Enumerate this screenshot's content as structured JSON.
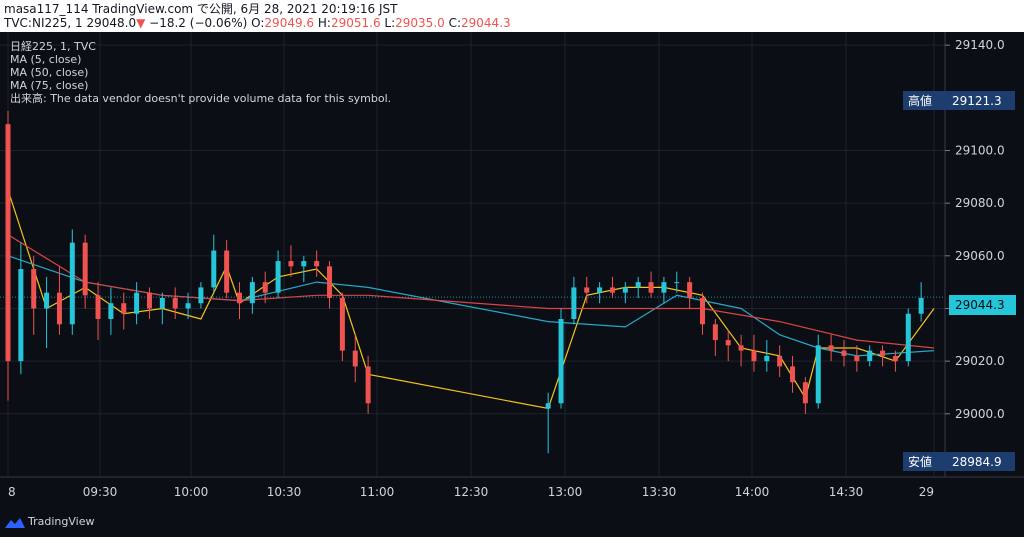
{
  "header": {
    "line1": "masa117_114 TradingView.com で公開, 6月 28, 2021 20:19:16 JST",
    "symbol": "TVC:NI225, 1",
    "last": "29048.0",
    "change_arrow": "▼",
    "change": "−18.2 (−0.06%)",
    "o_label": "O:",
    "o_value": "29049.6",
    "h_label": "H:",
    "h_value": "29051.6",
    "l_label": "L:",
    "l_value": "29035.0",
    "c_label": "C:",
    "c_value": "29044.3"
  },
  "legend": [
    "日経225, 1, TVC",
    "MA (5, close)",
    "MA (50, close)",
    "MA (75, close)",
    "出来高: The data vendor doesn't provide volume data for this symbol."
  ],
  "price_tags": {
    "high_label": "高値",
    "high_value": "29121.3",
    "low_label": "安値",
    "low_value": "28984.9",
    "last_value": "29044.3"
  },
  "footer": {
    "brand": "TradingView"
  },
  "colors": {
    "background": "#0c0e15",
    "up": "#26c6da",
    "down": "#ef5350",
    "ma5": "#f5c518",
    "ma50": "#26a8c8",
    "ma75": "#d94545",
    "tag_bg": "#1c3d6e",
    "last_bg": "#26c6da"
  },
  "chart_data": {
    "type": "candlestick",
    "y_ticks": [
      29000,
      29020,
      29040,
      29060,
      29080,
      29100,
      29140
    ],
    "x_ticks": [
      "8",
      "09:30",
      "10:00",
      "10:30",
      "11:00",
      "12:30",
      "13:00",
      "13:30",
      "14:00",
      "14:30",
      "29"
    ],
    "ylim": [
      28976,
      29145
    ],
    "series": [
      {
        "name": "MA (5, close)",
        "x": [
          "09:00",
          "09:15",
          "09:30",
          "09:45",
          "10:00",
          "10:15",
          "10:25",
          "10:30",
          "10:45",
          "11:00",
          "11:10",
          "11:20",
          "12:30",
          "12:45",
          "13:00",
          "13:15",
          "13:30",
          "13:45",
          "14:00",
          "14:10",
          "14:15",
          "14:30",
          "14:45",
          "15:00"
        ],
        "y": [
          29085,
          29040,
          29048,
          29038,
          29040,
          29036,
          29056,
          29042,
          29052,
          29055,
          29045,
          29015,
          29002,
          29045,
          29048,
          29048,
          29045,
          29025,
          29022,
          29006,
          29025,
          29025,
          29020,
          29040
        ]
      },
      {
        "name": "MA (50, close)",
        "x": [
          "09:00",
          "09:30",
          "10:00",
          "10:30",
          "11:00",
          "11:20",
          "12:30",
          "13:00",
          "13:20",
          "13:45",
          "14:00",
          "14:15",
          "14:30",
          "15:00"
        ],
        "y": [
          29060,
          29050,
          29045,
          29043,
          29050,
          29048,
          29035,
          29033,
          29045,
          29040,
          29030,
          29025,
          29022,
          29024
        ]
      },
      {
        "name": "MA (75, close)",
        "x": [
          "09:00",
          "09:30",
          "10:00",
          "10:30",
          "11:00",
          "11:20",
          "12:30",
          "13:00",
          "13:30",
          "14:00",
          "14:30",
          "15:00"
        ],
        "y": [
          29068,
          29050,
          29045,
          29043,
          29045,
          29045,
          29040,
          29040,
          29040,
          29035,
          29028,
          29025
        ]
      }
    ],
    "candles": [
      {
        "t": "09:00",
        "o": 29110,
        "h": 29115,
        "l": 29005,
        "c": 29020
      },
      {
        "t": "09:05",
        "o": 29020,
        "h": 29065,
        "l": 29015,
        "c": 29055
      },
      {
        "t": "09:10",
        "o": 29055,
        "h": 29060,
        "l": 29030,
        "c": 29040
      },
      {
        "t": "09:15",
        "o": 29040,
        "h": 29052,
        "l": 29025,
        "c": 29046
      },
      {
        "t": "09:20",
        "o": 29046,
        "h": 29056,
        "l": 29030,
        "c": 29034
      },
      {
        "t": "09:25",
        "o": 29034,
        "h": 29070,
        "l": 29030,
        "c": 29065
      },
      {
        "t": "09:30",
        "o": 29065,
        "h": 29068,
        "l": 29040,
        "c": 29045
      },
      {
        "t": "09:35",
        "o": 29045,
        "h": 29050,
        "l": 29028,
        "c": 29036
      },
      {
        "t": "09:40",
        "o": 29036,
        "h": 29048,
        "l": 29030,
        "c": 29042
      },
      {
        "t": "09:45",
        "o": 29042,
        "h": 29046,
        "l": 29032,
        "c": 29038
      },
      {
        "t": "09:50",
        "o": 29038,
        "h": 29050,
        "l": 29034,
        "c": 29046
      },
      {
        "t": "09:55",
        "o": 29046,
        "h": 29048,
        "l": 29036,
        "c": 29040
      },
      {
        "t": "10:00",
        "o": 29040,
        "h": 29046,
        "l": 29034,
        "c": 29044
      },
      {
        "t": "10:05",
        "o": 29044,
        "h": 29048,
        "l": 29036,
        "c": 29040
      },
      {
        "t": "10:10",
        "o": 29040,
        "h": 29046,
        "l": 29036,
        "c": 29042
      },
      {
        "t": "10:15",
        "o": 29042,
        "h": 29050,
        "l": 29040,
        "c": 29048
      },
      {
        "t": "10:20",
        "o": 29048,
        "h": 29068,
        "l": 29046,
        "c": 29062
      },
      {
        "t": "10:25",
        "o": 29062,
        "h": 29066,
        "l": 29044,
        "c": 29046
      },
      {
        "t": "10:30",
        "o": 29046,
        "h": 29050,
        "l": 29036,
        "c": 29042
      },
      {
        "t": "10:35",
        "o": 29042,
        "h": 29052,
        "l": 29038,
        "c": 29050
      },
      {
        "t": "10:40",
        "o": 29050,
        "h": 29054,
        "l": 29042,
        "c": 29046
      },
      {
        "t": "10:45",
        "o": 29046,
        "h": 29062,
        "l": 29044,
        "c": 29058
      },
      {
        "t": "10:50",
        "o": 29058,
        "h": 29064,
        "l": 29052,
        "c": 29056
      },
      {
        "t": "10:55",
        "o": 29056,
        "h": 29060,
        "l": 29050,
        "c": 29058
      },
      {
        "t": "11:00",
        "o": 29058,
        "h": 29062,
        "l": 29052,
        "c": 29056
      },
      {
        "t": "11:05",
        "o": 29056,
        "h": 29058,
        "l": 29040,
        "c": 29044
      },
      {
        "t": "11:10",
        "o": 29044,
        "h": 29046,
        "l": 29020,
        "c": 29024
      },
      {
        "t": "11:15",
        "o": 29024,
        "h": 29030,
        "l": 29012,
        "c": 29018
      },
      {
        "t": "11:20",
        "o": 29018,
        "h": 29022,
        "l": 29000,
        "c": 29004
      },
      {
        "t": "12:30",
        "o": 29002,
        "h": 29008,
        "l": 28985,
        "c": 29004
      },
      {
        "t": "12:35",
        "o": 29004,
        "h": 29040,
        "l": 29002,
        "c": 29036
      },
      {
        "t": "12:40",
        "o": 29036,
        "h": 29052,
        "l": 29034,
        "c": 29048
      },
      {
        "t": "12:45",
        "o": 29048,
        "h": 29052,
        "l": 29042,
        "c": 29046
      },
      {
        "t": "12:50",
        "o": 29046,
        "h": 29050,
        "l": 29042,
        "c": 29048
      },
      {
        "t": "12:55",
        "o": 29048,
        "h": 29052,
        "l": 29044,
        "c": 29046
      },
      {
        "t": "13:00",
        "o": 29046,
        "h": 29050,
        "l": 29042,
        "c": 29048
      },
      {
        "t": "13:05",
        "o": 29048,
        "h": 29052,
        "l": 29044,
        "c": 29050
      },
      {
        "t": "13:10",
        "o": 29050,
        "h": 29054,
        "l": 29044,
        "c": 29046
      },
      {
        "t": "13:15",
        "o": 29046,
        "h": 29052,
        "l": 29042,
        "c": 29050
      },
      {
        "t": "13:20",
        "o": 29050,
        "h": 29054,
        "l": 29046,
        "c": 29050
      },
      {
        "t": "13:25",
        "o": 29050,
        "h": 29052,
        "l": 29040,
        "c": 29044
      },
      {
        "t": "13:30",
        "o": 29044,
        "h": 29046,
        "l": 29030,
        "c": 29034
      },
      {
        "t": "13:35",
        "o": 29034,
        "h": 29036,
        "l": 29022,
        "c": 29028
      },
      {
        "t": "13:40",
        "o": 29028,
        "h": 29032,
        "l": 29020,
        "c": 29026
      },
      {
        "t": "13:45",
        "o": 29026,
        "h": 29030,
        "l": 29018,
        "c": 29024
      },
      {
        "t": "13:50",
        "o": 29024,
        "h": 29030,
        "l": 29016,
        "c": 29020
      },
      {
        "t": "13:55",
        "o": 29020,
        "h": 29028,
        "l": 29016,
        "c": 29022
      },
      {
        "t": "14:00",
        "o": 29022,
        "h": 29026,
        "l": 29014,
        "c": 29018
      },
      {
        "t": "14:05",
        "o": 29018,
        "h": 29022,
        "l": 29008,
        "c": 29012
      },
      {
        "t": "14:10",
        "o": 29012,
        "h": 29014,
        "l": 29000,
        "c": 29004
      },
      {
        "t": "14:15",
        "o": 29004,
        "h": 29030,
        "l": 29002,
        "c": 29026
      },
      {
        "t": "14:20",
        "o": 29026,
        "h": 29030,
        "l": 29020,
        "c": 29024
      },
      {
        "t": "14:25",
        "o": 29024,
        "h": 29028,
        "l": 29018,
        "c": 29022
      },
      {
        "t": "14:30",
        "o": 29022,
        "h": 29026,
        "l": 29016,
        "c": 29020
      },
      {
        "t": "14:35",
        "o": 29020,
        "h": 29026,
        "l": 29018,
        "c": 29024
      },
      {
        "t": "14:40",
        "o": 29024,
        "h": 29026,
        "l": 29018,
        "c": 29022
      },
      {
        "t": "14:45",
        "o": 29022,
        "h": 29024,
        "l": 29016,
        "c": 29020
      },
      {
        "t": "14:50",
        "o": 29020,
        "h": 29040,
        "l": 29018,
        "c": 29038
      },
      {
        "t": "14:55",
        "o": 29038,
        "h": 29050,
        "l": 29035,
        "c": 29044
      }
    ]
  }
}
